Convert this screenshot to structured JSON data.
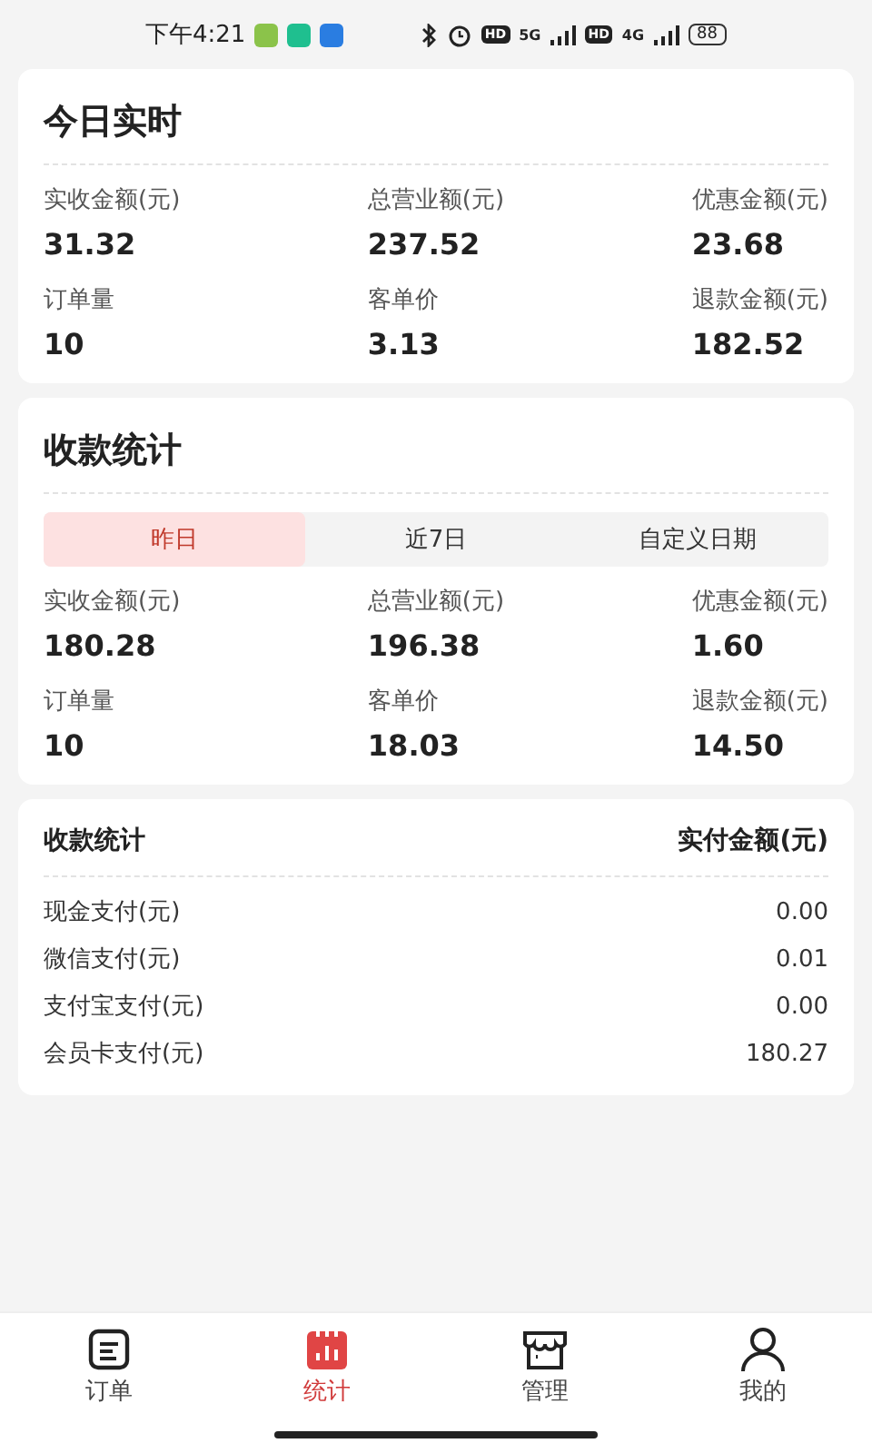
{
  "status_bar": {
    "time": "下午4:21",
    "network_1": "5G",
    "network_2": "4G",
    "hd_1": "HD",
    "hd_2": "HD",
    "battery": "88"
  },
  "today": {
    "title": "今日实时",
    "stats": [
      {
        "label": "实收金额(元)",
        "value": "31.32"
      },
      {
        "label": "总营业额(元)",
        "value": "237.52"
      },
      {
        "label": "优惠金额(元)",
        "value": "23.68"
      },
      {
        "label": "订单量",
        "value": "10"
      },
      {
        "label": "客单价",
        "value": "3.13"
      },
      {
        "label": "退款金额(元)",
        "value": "182.52"
      }
    ]
  },
  "collection": {
    "title": "收款统计",
    "tabs": [
      {
        "label": "昨日",
        "selected": true
      },
      {
        "label": "近7日",
        "selected": false
      },
      {
        "label": "自定义日期",
        "selected": false
      }
    ],
    "stats": [
      {
        "label": "实收金额(元)",
        "value": "180.28"
      },
      {
        "label": "总营业额(元)",
        "value": "196.38"
      },
      {
        "label": "优惠金额(元)",
        "value": "1.60"
      },
      {
        "label": "订单量",
        "value": "10"
      },
      {
        "label": "客单价",
        "value": "18.03"
      },
      {
        "label": "退款金额(元)",
        "value": "14.50"
      }
    ]
  },
  "payments": {
    "header": "收款统计",
    "amount_header": "实付金额(元)",
    "rows": [
      {
        "method": "现金支付(元)",
        "amount": "0.00"
      },
      {
        "method": "微信支付(元)",
        "amount": "0.01"
      },
      {
        "method": "支付宝支付(元)",
        "amount": "0.00"
      },
      {
        "method": "会员卡支付(元)",
        "amount": "180.27"
      }
    ]
  },
  "tab_bar": [
    {
      "label": "订单",
      "selected": false
    },
    {
      "label": "统计",
      "selected": true
    },
    {
      "label": "管理",
      "selected": false
    },
    {
      "label": "我的",
      "selected": false
    }
  ]
}
